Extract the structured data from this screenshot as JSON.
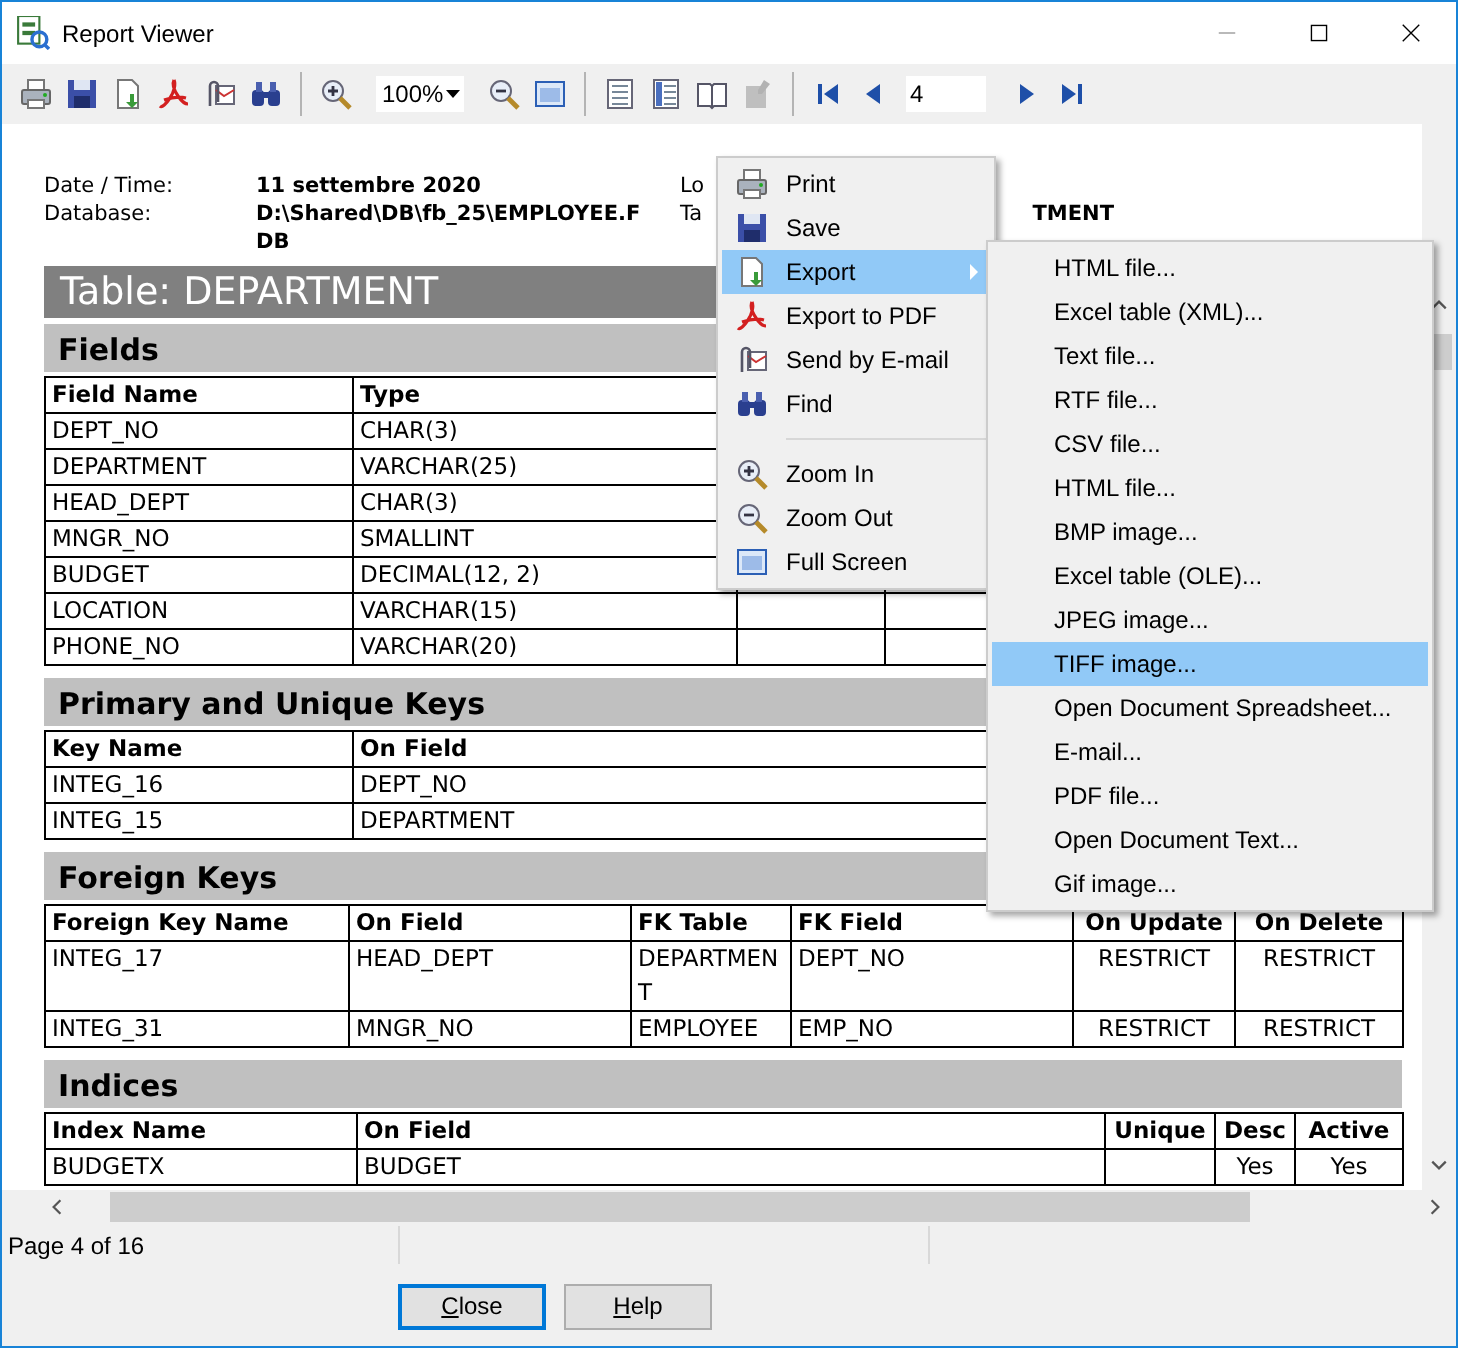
{
  "window": {
    "title": "Report Viewer"
  },
  "toolbar": {
    "items": [
      {
        "kind": "button",
        "disabled": false
      },
      {
        "kind": "button",
        "disabled": false
      },
      {
        "kind": "button",
        "disabled": false
      },
      {
        "kind": "button",
        "disabled": false
      },
      {
        "kind": "button",
        "disabled": false
      },
      {
        "kind": "button",
        "disabled": false
      },
      {
        "kind": "separator"
      },
      {
        "kind": "button",
        "disabled": false
      },
      {
        "kind": "combo",
        "value": "100%"
      },
      {
        "kind": "button",
        "disabled": false
      },
      {
        "kind": "button",
        "disabled": false
      },
      {
        "kind": "separator"
      },
      {
        "kind": "button",
        "disabled": false
      },
      {
        "kind": "button",
        "disabled": false
      },
      {
        "kind": "button",
        "disabled": false
      },
      {
        "kind": "button",
        "disabled": true
      },
      {
        "kind": "separator"
      },
      {
        "kind": "button",
        "disabled": false
      },
      {
        "kind": "button",
        "disabled": false
      },
      {
        "kind": "field",
        "value": "4"
      },
      {
        "kind": "button",
        "disabled": false
      },
      {
        "kind": "button",
        "disabled": false
      }
    ]
  },
  "report": {
    "info": [
      {
        "label": "Date / Time:",
        "value": "11 settembre 2020",
        "side_label": "Lo"
      },
      {
        "label": "Database:",
        "value": "D:\\Shared\\DB\\fb_25\\EMPLOYEE.FDB",
        "side_label": "Ta",
        "side_value": "TMENT"
      }
    ],
    "title": "Table: DEPARTMENT",
    "sections": [
      {
        "title": "Fields",
        "columns": [
          "Field Name",
          "Type",
          null,
          null,
          null
        ],
        "rows": [
          [
            "DEPT_NO",
            "CHAR(3)",
            null,
            null,
            null
          ],
          [
            "DEPARTMENT",
            "VARCHAR(25)",
            null,
            null,
            null
          ],
          [
            "HEAD_DEPT",
            "CHAR(3)",
            null,
            null,
            null
          ],
          [
            "MNGR_NO",
            "SMALLINT",
            null,
            null,
            null
          ],
          [
            "BUDGET",
            "DECIMAL(12, 2)",
            null,
            null,
            null
          ],
          [
            "LOCATION",
            "VARCHAR(15)",
            null,
            null,
            null
          ],
          [
            "PHONE_NO",
            "VARCHAR(20)",
            null,
            null,
            null
          ]
        ]
      },
      {
        "title": "Primary and Unique Keys",
        "columns": [
          "Key Name",
          "On Field"
        ],
        "rows": [
          [
            "INTEG_16",
            "DEPT_NO"
          ],
          [
            "INTEG_15",
            "DEPARTMENT"
          ]
        ]
      },
      {
        "title": "Foreign Keys",
        "columns": [
          "Foreign Key Name",
          "On Field",
          "FK Table",
          "FK Field",
          "On Update",
          "On Delete"
        ],
        "rows": [
          [
            "INTEG_17",
            "HEAD_DEPT",
            "DEPARTMENT",
            "DEPT_NO",
            "RESTRICT",
            "RESTRICT"
          ],
          [
            "INTEG_31",
            "MNGR_NO",
            "EMPLOYEE",
            "EMP_NO",
            "RESTRICT",
            "RESTRICT"
          ]
        ]
      },
      {
        "title": "Indices",
        "columns": [
          "Index Name",
          "On Field",
          "Unique",
          "Desc",
          "Active"
        ],
        "rows": [
          [
            "BUDGETX",
            "BUDGET",
            null,
            "Yes",
            "Yes"
          ]
        ]
      }
    ]
  },
  "context_menu": {
    "items": [
      {
        "kind": "item",
        "label": "Print",
        "selected": false,
        "submenu": false
      },
      {
        "kind": "item",
        "label": "Save",
        "selected": false,
        "submenu": false
      },
      {
        "kind": "item",
        "label": "Export",
        "selected": true,
        "submenu": true
      },
      {
        "kind": "item",
        "label": "Export to PDF",
        "selected": false,
        "submenu": false
      },
      {
        "kind": "item",
        "label": "Send by E-mail",
        "selected": false,
        "submenu": false
      },
      {
        "kind": "item",
        "label": "Find",
        "selected": false,
        "submenu": false
      },
      {
        "kind": "separator"
      },
      {
        "kind": "item",
        "label": "Zoom In",
        "selected": false,
        "submenu": false
      },
      {
        "kind": "item",
        "label": "Zoom Out",
        "selected": false,
        "submenu": false
      },
      {
        "kind": "item",
        "label": "Full Screen",
        "selected": false,
        "submenu": false
      }
    ]
  },
  "submenu": {
    "items": [
      {
        "label": "HTML file...",
        "selected": false
      },
      {
        "label": "Excel table (XML)...",
        "selected": false
      },
      {
        "label": "Text file...",
        "selected": false
      },
      {
        "label": "RTF file...",
        "selected": false
      },
      {
        "label": "CSV file...",
        "selected": false
      },
      {
        "label": "HTML file...",
        "selected": false
      },
      {
        "label": "BMP image...",
        "selected": false
      },
      {
        "label": "Excel table (OLE)...",
        "selected": false
      },
      {
        "label": "JPEG image...",
        "selected": false
      },
      {
        "label": "TIFF image...",
        "selected": true
      },
      {
        "label": "Open Document Spreadsheet...",
        "selected": false
      },
      {
        "label": "E-mail...",
        "selected": false
      },
      {
        "label": "PDF file...",
        "selected": false
      },
      {
        "label": "Open Document Text...",
        "selected": false
      },
      {
        "label": "Gif image...",
        "selected": false
      }
    ]
  },
  "status_bar": {
    "text": "Page 4 of 16"
  },
  "buttons": [
    {
      "label": "Close",
      "default": true,
      "underline_first": true
    },
    {
      "label": "Help",
      "default": false,
      "underline_first": true
    }
  ]
}
